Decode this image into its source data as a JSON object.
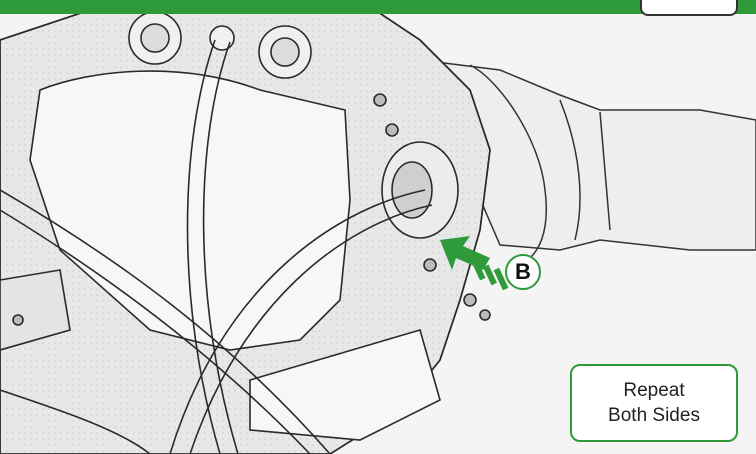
{
  "callout": {
    "label": "B"
  },
  "note": {
    "line1": "Repeat",
    "line2": "Both Sides"
  },
  "colors": {
    "accent": "#2e9a3a",
    "ink": "#222222"
  },
  "icons": {
    "arrow": "green-arrow-icon"
  }
}
